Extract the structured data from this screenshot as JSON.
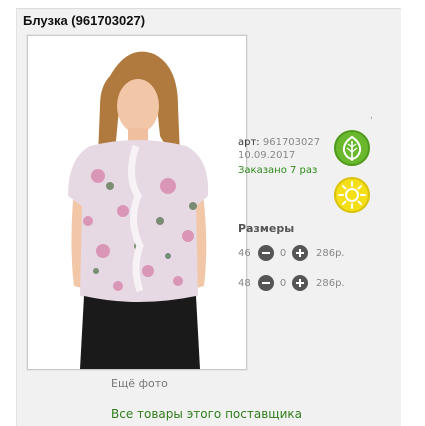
{
  "product": {
    "title": "Блузка (961703027)",
    "article_label": "арт:",
    "article": "961703027",
    "date": "10.09.2017",
    "ordered": "Заказано 7 раз",
    "more_photos": "Ещё фото",
    "supplier_link": "Все товары этого поставщика"
  },
  "sizes": {
    "title": "Размеры",
    "rows": [
      {
        "size": "46",
        "qty": "0",
        "price": "286р."
      },
      {
        "size": "48",
        "qty": "0",
        "price": "286р."
      }
    ]
  },
  "badges": {
    "eco_color": "#6ab82e",
    "sun_color": "#f4df16",
    "eco_icon": "leaf-icon",
    "sun_icon": "sun-icon"
  },
  "colors": {
    "link_green": "#2f7d1a",
    "panel_bg": "#f1f1f1",
    "button_dark": "#555555"
  }
}
